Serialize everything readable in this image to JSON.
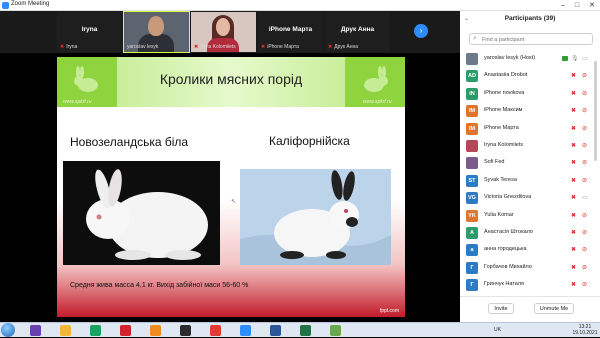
{
  "window": {
    "title": "Zoom Meeting"
  },
  "gallery": {
    "tiles": [
      {
        "name": "Iryna",
        "label": "Iryna"
      },
      {
        "name": "",
        "label": "yaroslav lesyk"
      },
      {
        "name": "",
        "label": "Iryna Kolomiiets"
      },
      {
        "name": "iPhone Марта",
        "label": "iPhone Марта"
      },
      {
        "name": "Друк Анна",
        "label": "Друк Анна"
      }
    ]
  },
  "slide": {
    "title": "Кролики мясних порід",
    "breed_left": "Новозеландська біла",
    "breed_right": "Каліфорнійска",
    "caption": "Средня жива масса 4,1 кг. Вихід забійної маси 56-60 %",
    "watermark_left": "www.spkrf.ru",
    "watermark_right": "www.spkrf.ru",
    "footer": "fppt.com"
  },
  "participants": {
    "title": "Participants (39)",
    "search_placeholder": "Find a participant",
    "list": [
      {
        "initials": "",
        "name": "yaroslav lesyk (Host)",
        "color": "#6c7a89",
        "mic_on": true,
        "cam_on": true
      },
      {
        "initials": "AD",
        "name": "Anastasiia Drobot",
        "color": "#2e9c6a",
        "mic_on": false,
        "cam_on": false
      },
      {
        "initials": "IN",
        "name": "iPhone novikova",
        "color": "#2e9c6a",
        "mic_on": false,
        "cam_on": false
      },
      {
        "initials": "IM",
        "name": "iPhone Максим",
        "color": "#e0752d",
        "mic_on": false,
        "cam_on": false
      },
      {
        "initials": "IM",
        "name": "iPhone Марта",
        "color": "#e0752d",
        "mic_on": false,
        "cam_on": false
      },
      {
        "initials": "",
        "name": "Iryna Kolomiiets",
        "color": "#b5475a",
        "mic_on": false,
        "cam_on": false
      },
      {
        "initials": "",
        "name": "Sofi Fed",
        "color": "#7b5a8c",
        "mic_on": false,
        "cam_on": false
      },
      {
        "initials": "ST",
        "name": "Syvak Teresa",
        "color": "#2d7bc4",
        "mic_on": false,
        "cam_on": false
      },
      {
        "initials": "VG",
        "name": "Victoria Gnezdilova",
        "color": "#2d7bc4",
        "mic_on": false,
        "cam_on": true
      },
      {
        "initials": "YK",
        "name": "Yulia Komar",
        "color": "#e0752d",
        "mic_on": false,
        "cam_on": false
      },
      {
        "initials": "A",
        "name": "Анастасія Штокало",
        "color": "#2e9c6a",
        "mic_on": false,
        "cam_on": false
      },
      {
        "initials": "a",
        "name": "анна городецька",
        "color": "#2d7bc4",
        "mic_on": false,
        "cam_on": false
      },
      {
        "initials": "Г",
        "name": "Горбачов Михайло",
        "color": "#2d7bc4",
        "mic_on": false,
        "cam_on": false
      },
      {
        "initials": "Г",
        "name": "Гринчук Наталя",
        "color": "#2d7bc4",
        "mic_on": false,
        "cam_on": false
      }
    ],
    "invite_label": "Invite",
    "unmute_label": "Unmute Me"
  },
  "taskbar": {
    "lang": "UK",
    "time": "13:21",
    "date": "19.10.2021",
    "icons": [
      "windows-media",
      "file-explorer",
      "chrome",
      "opera",
      "vlc",
      "terminal",
      "yandex",
      "zoom",
      "word",
      "excel",
      "paint"
    ]
  },
  "colors": {
    "zoom_blue": "#2d8cff",
    "muted_red": "#e02828",
    "slide_green": "#8fd33f"
  }
}
